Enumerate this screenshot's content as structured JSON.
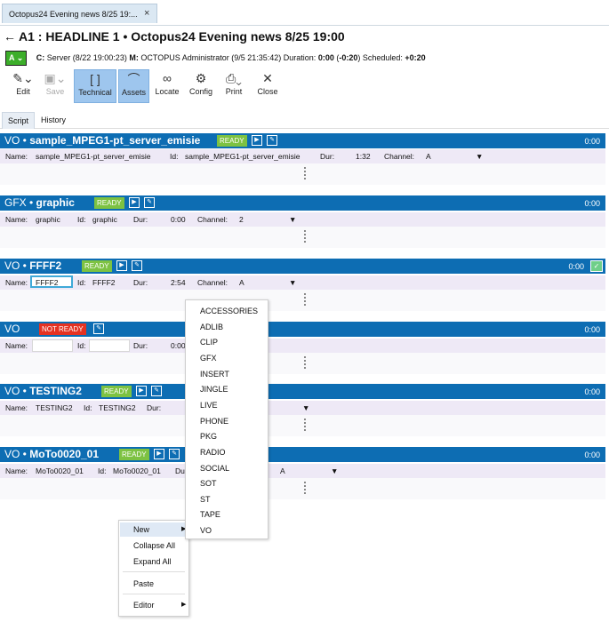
{
  "tab": {
    "label": "Octopus24 Evening news 8/25 19:...",
    "close": "×"
  },
  "title": "A1 : HEADLINE 1 • Octopus24 Evening news 8/25 19:00",
  "status": {
    "badge": "A",
    "created_label": "C:",
    "created_value": "Server (8/22 19:00:23)",
    "modified_label": "M:",
    "modified_value": "OCTOPUS Administrator (9/5 21:35:42)",
    "duration_label": "Duration:",
    "duration_value": "0:00",
    "duration_diff": "-0:20",
    "scheduled_label": "Scheduled:",
    "scheduled_value": "+0:20"
  },
  "toolbar": {
    "edit": "Edit",
    "save": "Save",
    "technical": "Technical",
    "assets": "Assets",
    "locate": "Locate",
    "config": "Config",
    "print": "Print",
    "close": "Close"
  },
  "subtabs": {
    "script": "Script",
    "history": "History"
  },
  "labels": {
    "name": "Name:",
    "id": "Id:",
    "dur": "Dur:",
    "channel": "Channel:",
    "ready": "READY",
    "not_ready": "NOT READY"
  },
  "blocks": [
    {
      "type": "VO",
      "name": "sample_MPEG1-pt_server_emisie",
      "status": "READY",
      "duration": "0:00",
      "field_name": "sample_MPEG1-pt_server_emisie",
      "field_id": "sample_MPEG1-pt_server_emisie",
      "field_dur": "1:32",
      "field_channel": "A"
    },
    {
      "type": "GFX",
      "name": "graphic",
      "status": "READY",
      "duration": "0:00",
      "field_name": "graphic",
      "field_id": "graphic",
      "field_dur": "0:00",
      "field_channel": "2"
    },
    {
      "type": "VO",
      "name": "FFFF2",
      "status": "READY",
      "duration": "0:00",
      "field_name": "FFFF2",
      "field_id": "FFFF2",
      "field_dur": "2:54",
      "field_channel": "A"
    },
    {
      "type": "VO",
      "name": "",
      "status": "NOT READY",
      "duration": "0:00",
      "field_name": "",
      "field_id": "",
      "field_dur": "0:00",
      "field_channel": ""
    },
    {
      "type": "VO",
      "name": "TESTING2",
      "status": "READY",
      "duration": "0:00",
      "field_name": "TESTING2",
      "field_id": "TESTING2",
      "field_dur": "",
      "field_channel": ""
    },
    {
      "type": "VO",
      "name": "MoTo0020_01",
      "status": "READY",
      "duration": "0:00",
      "field_name": "MoTo0020_01",
      "field_id": "MoTo0020_01",
      "field_dur": "",
      "field_channel": "A"
    }
  ],
  "context_menu": {
    "new": "New",
    "collapse_all": "Collapse All",
    "expand_all": "Expand All",
    "paste": "Paste",
    "editor": "Editor"
  },
  "submenu": [
    "ACCESSORIES",
    "ADLIB",
    "CLIP",
    "GFX",
    "INSERT",
    "JINGLE",
    "LIVE",
    "PHONE",
    "PKG",
    "RADIO",
    "SOCIAL",
    "SOT",
    "ST",
    "TAPE",
    "VO"
  ]
}
